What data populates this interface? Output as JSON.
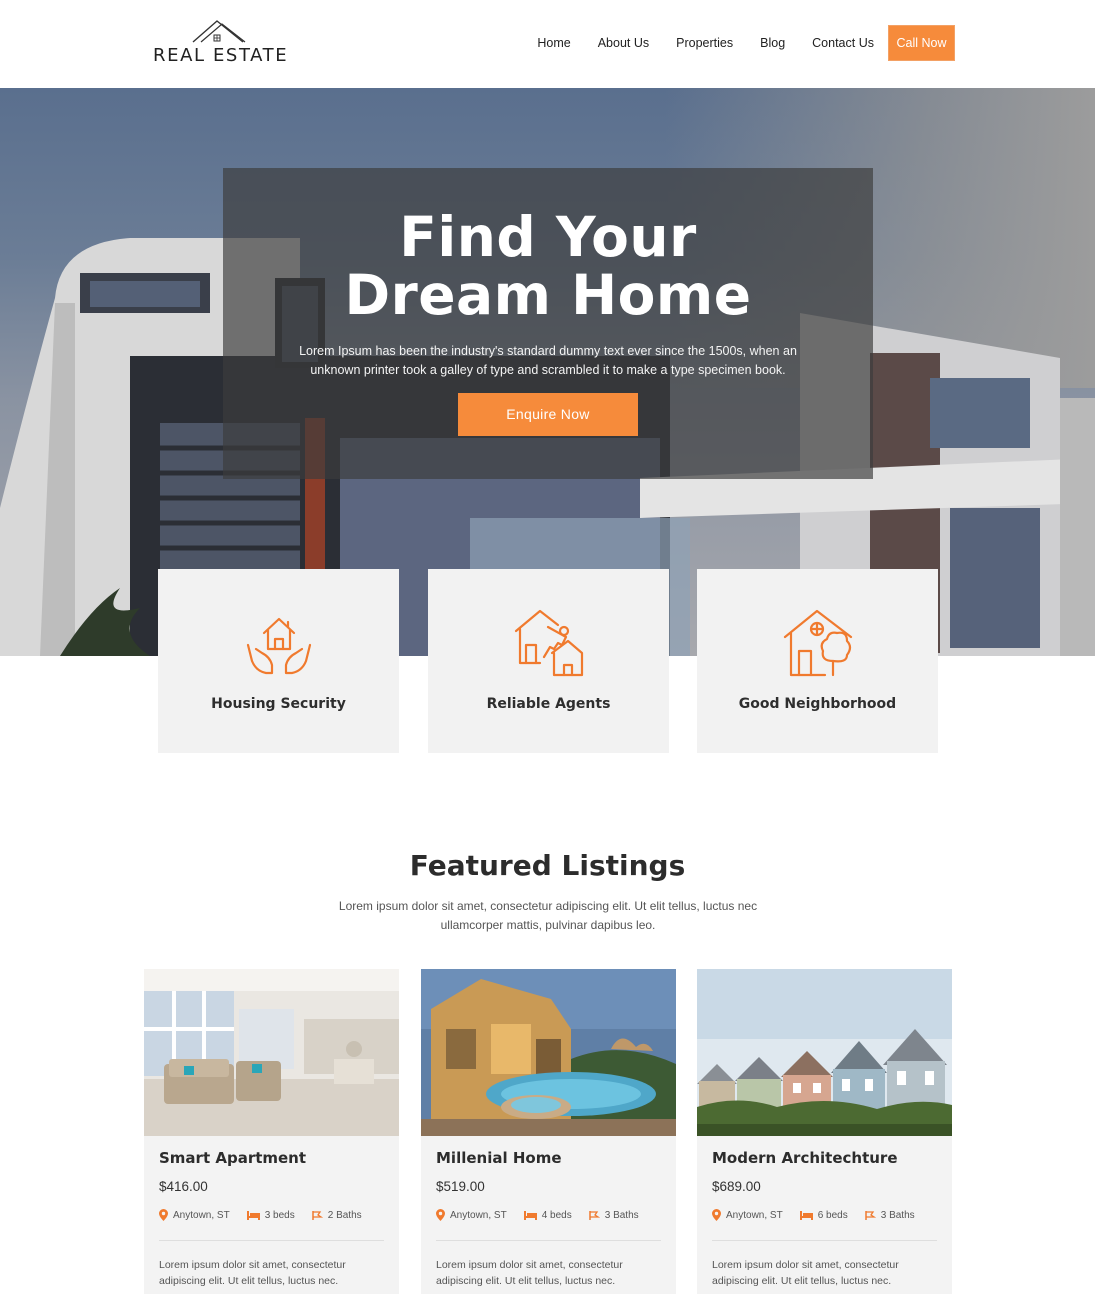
{
  "brand": {
    "logo_text": "REAL ESTATE"
  },
  "nav": {
    "items": [
      "Home",
      "About Us",
      "Properties",
      "Blog",
      "Contact Us"
    ],
    "cta": "Call Now"
  },
  "hero": {
    "title_line1": "Find Your",
    "title_line2": "Dream Home",
    "subtitle": "Lorem Ipsum has been the industry's standard dummy text ever since the 1500s, when an unknown printer took a galley of type and scrambled it to make a type specimen book.",
    "button": "Enquire Now"
  },
  "features": [
    {
      "label": "Housing Security",
      "icon": "house-hands-icon"
    },
    {
      "label": "Reliable Agents",
      "icon": "house-key-icon"
    },
    {
      "label": "Good Neighborhood",
      "icon": "house-tree-icon"
    }
  ],
  "listings_section": {
    "title": "Featured Listings",
    "subtitle": "Lorem ipsum dolor sit amet, consectetur adipiscing elit. Ut elit tellus, luctus nec ullamcorper mattis, pulvinar dapibus leo."
  },
  "listings": [
    {
      "title": "Smart Apartment",
      "price": "$416.00",
      "location": "Anytown, ST",
      "beds": "3 beds",
      "baths": "2 Baths",
      "desc": "Lorem ipsum dolor sit amet, consectetur adipiscing elit. Ut elit tellus, luctus nec."
    },
    {
      "title": "Millenial Home",
      "price": "$519.00",
      "location": "Anytown, ST",
      "beds": "4 beds",
      "baths": "3 Baths",
      "desc": "Lorem ipsum dolor sit amet, consectetur adipiscing elit. Ut elit tellus, luctus nec."
    },
    {
      "title": "Modern Architechture",
      "price": "$689.00",
      "location": "Anytown, ST",
      "beds": "6 beds",
      "baths": "3 Baths",
      "desc": "Lorem ipsum dolor sit amet, consectetur adipiscing elit. Ut elit tellus, luctus nec."
    }
  ],
  "colors": {
    "accent": "#f68b3b",
    "card_bg": "#f2f2f2",
    "text_dark": "#2c2c2c"
  }
}
